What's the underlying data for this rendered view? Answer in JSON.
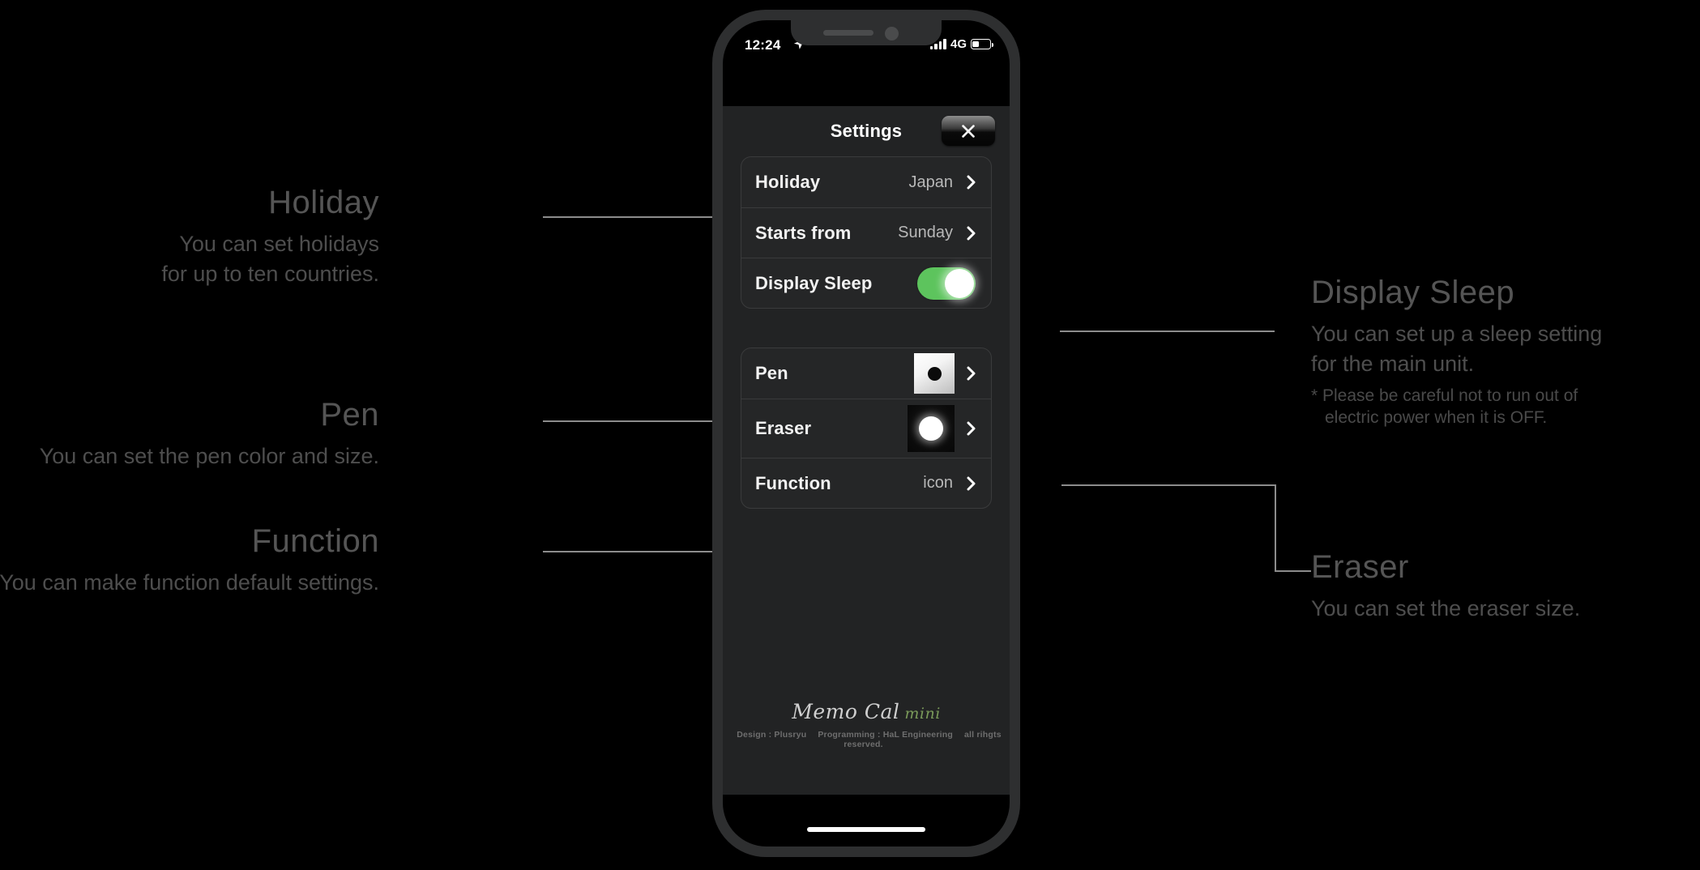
{
  "phone": {
    "status_bar": {
      "time": "12:24",
      "location_icon": "location-arrow-icon",
      "network": "4G",
      "signal_icon": "signal-bars-icon",
      "battery_icon": "battery-icon"
    },
    "home_indicator": "home-indicator"
  },
  "app": {
    "title": "Settings",
    "close_icon": "close-x-icon",
    "groups": [
      {
        "name": "calendar-group",
        "rows": [
          {
            "label": "Holiday",
            "value": "Japan",
            "control": "chevron"
          },
          {
            "label": "Starts from",
            "value": "Sunday",
            "control": "chevron"
          },
          {
            "label": "Display Sleep",
            "value": "",
            "control": "toggle",
            "toggle_on": true
          }
        ]
      },
      {
        "name": "tools-group",
        "rows": [
          {
            "label": "Pen",
            "value": "",
            "control": "chevron",
            "swatch": "pen-swatch"
          },
          {
            "label": "Eraser",
            "value": "",
            "control": "chevron",
            "swatch": "eraser-swatch"
          },
          {
            "label": "Function",
            "value": "icon",
            "control": "chevron"
          }
        ]
      }
    ],
    "brand": {
      "name": "Memo Cal",
      "suffix": "mini",
      "credit_design": "Design : Plusryu",
      "credit_programming": "Programming : HaL Engineering",
      "credit_rights": "all rihgts reserved."
    }
  },
  "annotations": {
    "holiday": {
      "title": "Holiday",
      "line1": "You can set holidays",
      "line2": "for up to ten countries."
    },
    "pen": {
      "title": "Pen",
      "line1": "You can set the pen color and size."
    },
    "function": {
      "title": "Function",
      "line1": "You can make function default settings."
    },
    "display_sleep": {
      "title": "Display Sleep",
      "line1": "You can set up a sleep setting",
      "line2": "for the main unit.",
      "note1": "* Please be careful not to run out of",
      "note2": "electric power when it is OFF."
    },
    "eraser": {
      "title": "Eraser",
      "line1": "You can set the eraser size."
    }
  },
  "colors": {
    "background": "#000000",
    "toggle_on": "#5dc45d",
    "card": "#252627",
    "app_background": "#222324",
    "annotation_text": "#4e4e4e",
    "lead_line": "#8c8c8c",
    "brand_accent": "#7a9a5a"
  }
}
